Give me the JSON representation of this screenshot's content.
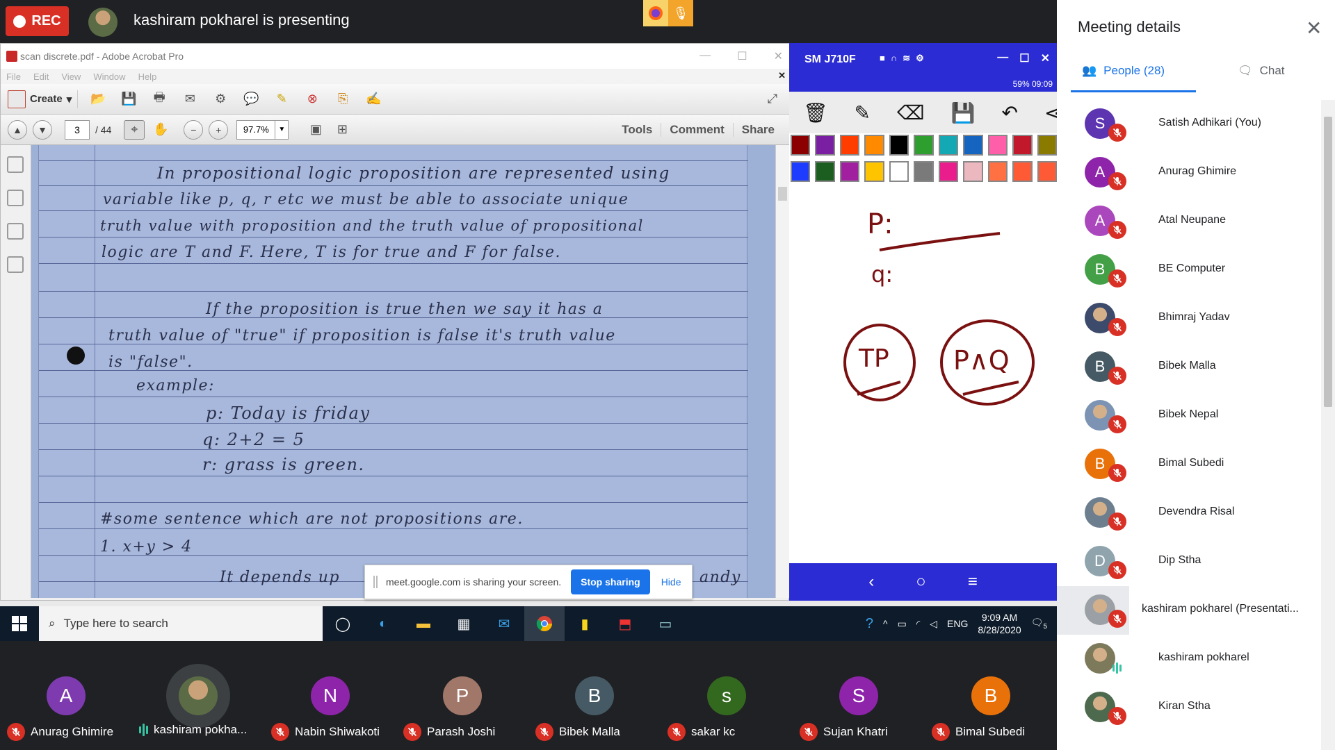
{
  "top_bar": {
    "rec_label": "REC",
    "presenter_text": "kashiram pokharel is presenting"
  },
  "acrobat": {
    "window_title": "scan discrete.pdf - Adobe Acrobat Pro",
    "menu": [
      "File",
      "Edit",
      "View",
      "Window",
      "Help"
    ],
    "create_label": "Create",
    "page_current": "3",
    "page_total": "/ 44",
    "zoom": "97.7%",
    "right_tabs": [
      "Tools",
      "Comment",
      "Share"
    ]
  },
  "handwriting": {
    "lines": [
      "In propositional logic proposition are represented using",
      "variable like p, q, r etc we must be able to associate unique",
      "truth value with proposition and the truth value of propositional",
      "logic are T and F. Here, T is for true and F for false.",
      "If the proposition is true then we say it has a",
      "truth value of \"true\" if proposition is false it's truth value",
      "is \"false\".",
      "example:",
      "p: Today is friday",
      "q: 2+2 = 5",
      "r: grass is green.",
      "#some sentence which are not propositions are.",
      "1. x+y > 4",
      "It depends up",
      "andy"
    ]
  },
  "share_banner": {
    "text": "meet.google.com is sharing your screen.",
    "stop_label": "Stop sharing",
    "hide_label": "Hide"
  },
  "phone": {
    "device_name": "SM J710F",
    "status": "59% 09:09",
    "palette_row1": [
      "#8b0000",
      "#7b1fa2",
      "#ff3d00",
      "#ff8a00",
      "#000000",
      "#2e9e2e",
      "#13a8b4",
      "#1565c0",
      "#ff5fa8",
      "#c2182b",
      "#8a7a00"
    ],
    "palette_row2": [
      "#1e3cff",
      "#1b5e20",
      "#a020a0",
      "#ffc400",
      "#ffffff",
      "#7a7a7a",
      "#e91e8c",
      "#ebb8c0",
      "#ff7043",
      "#ff5a36",
      "#ff5a36"
    ],
    "board": {
      "p_label": "P:",
      "q_label": "q:",
      "circle1": "TP",
      "circle2": "P∧Q"
    }
  },
  "taskbar": {
    "search_placeholder": "Type here to search",
    "lang": "ENG",
    "time": "9:09 AM",
    "date": "8/28/2020",
    "notif_count": "5"
  },
  "strip": [
    {
      "name": "Anurag Ghimire",
      "initial": "A",
      "color": "#7e3bb0",
      "muted": true
    },
    {
      "name": "kashiram pokha...",
      "initial": "",
      "color": "#5b6b45",
      "muted": false,
      "photo": true
    },
    {
      "name": "Nabin Shiwakoti",
      "initial": "N",
      "color": "#8e24aa",
      "muted": true
    },
    {
      "name": "Parash Joshi",
      "initial": "P",
      "color": "#a1776a",
      "muted": true
    },
    {
      "name": "Bibek Malla",
      "initial": "B",
      "color": "#455a64",
      "muted": true
    },
    {
      "name": "sakar kc",
      "initial": "s",
      "color": "#33691e",
      "muted": true
    },
    {
      "name": "Sujan Khatri",
      "initial": "S",
      "color": "#8e24aa",
      "muted": true
    },
    {
      "name": "Bimal Subedi",
      "initial": "B",
      "color": "#e8710a",
      "muted": true
    }
  ],
  "panel": {
    "title": "Meeting details",
    "tab_people": "People (28)",
    "tab_chat": "Chat",
    "people": [
      {
        "name": "Satish Adhikari (You)",
        "initial": "S",
        "color": "#5e35b1",
        "mic": "muted"
      },
      {
        "name": "Anurag Ghimire",
        "initial": "A",
        "color": "#8e24aa",
        "mic": "muted"
      },
      {
        "name": "Atal Neupane",
        "initial": "A",
        "color": "#ab47bc",
        "mic": "muted"
      },
      {
        "name": "BE Computer",
        "initial": "B",
        "color": "#43a047",
        "mic": "muted"
      },
      {
        "name": "Bhimraj Yadav",
        "initial": "",
        "color": "#3c4a6b",
        "mic": "muted",
        "photo": true
      },
      {
        "name": "Bibek Malla",
        "initial": "B",
        "color": "#455a64",
        "mic": "muted"
      },
      {
        "name": "Bibek Nepal",
        "initial": "",
        "color": "#7c93b3",
        "mic": "muted",
        "photo": true
      },
      {
        "name": "Bimal Subedi",
        "initial": "B",
        "color": "#e8710a",
        "mic": "muted"
      },
      {
        "name": "Devendra Risal",
        "initial": "",
        "color": "#6d7f8f",
        "mic": "muted",
        "photo": true
      },
      {
        "name": "Dip Stha",
        "initial": "D",
        "color": "#90a4ae",
        "mic": "muted"
      },
      {
        "name": "kashiram pokharel (Presentati...",
        "initial": "",
        "color": "#9aa0a6",
        "mic": "presenting",
        "photo": true
      },
      {
        "name": "kashiram pokharel",
        "initial": "",
        "color": "#7d7a5c",
        "mic": "speaking",
        "photo": true
      },
      {
        "name": "Kiran Stha",
        "initial": "",
        "color": "#4e6a4e",
        "mic": "muted",
        "photo": true
      }
    ]
  }
}
